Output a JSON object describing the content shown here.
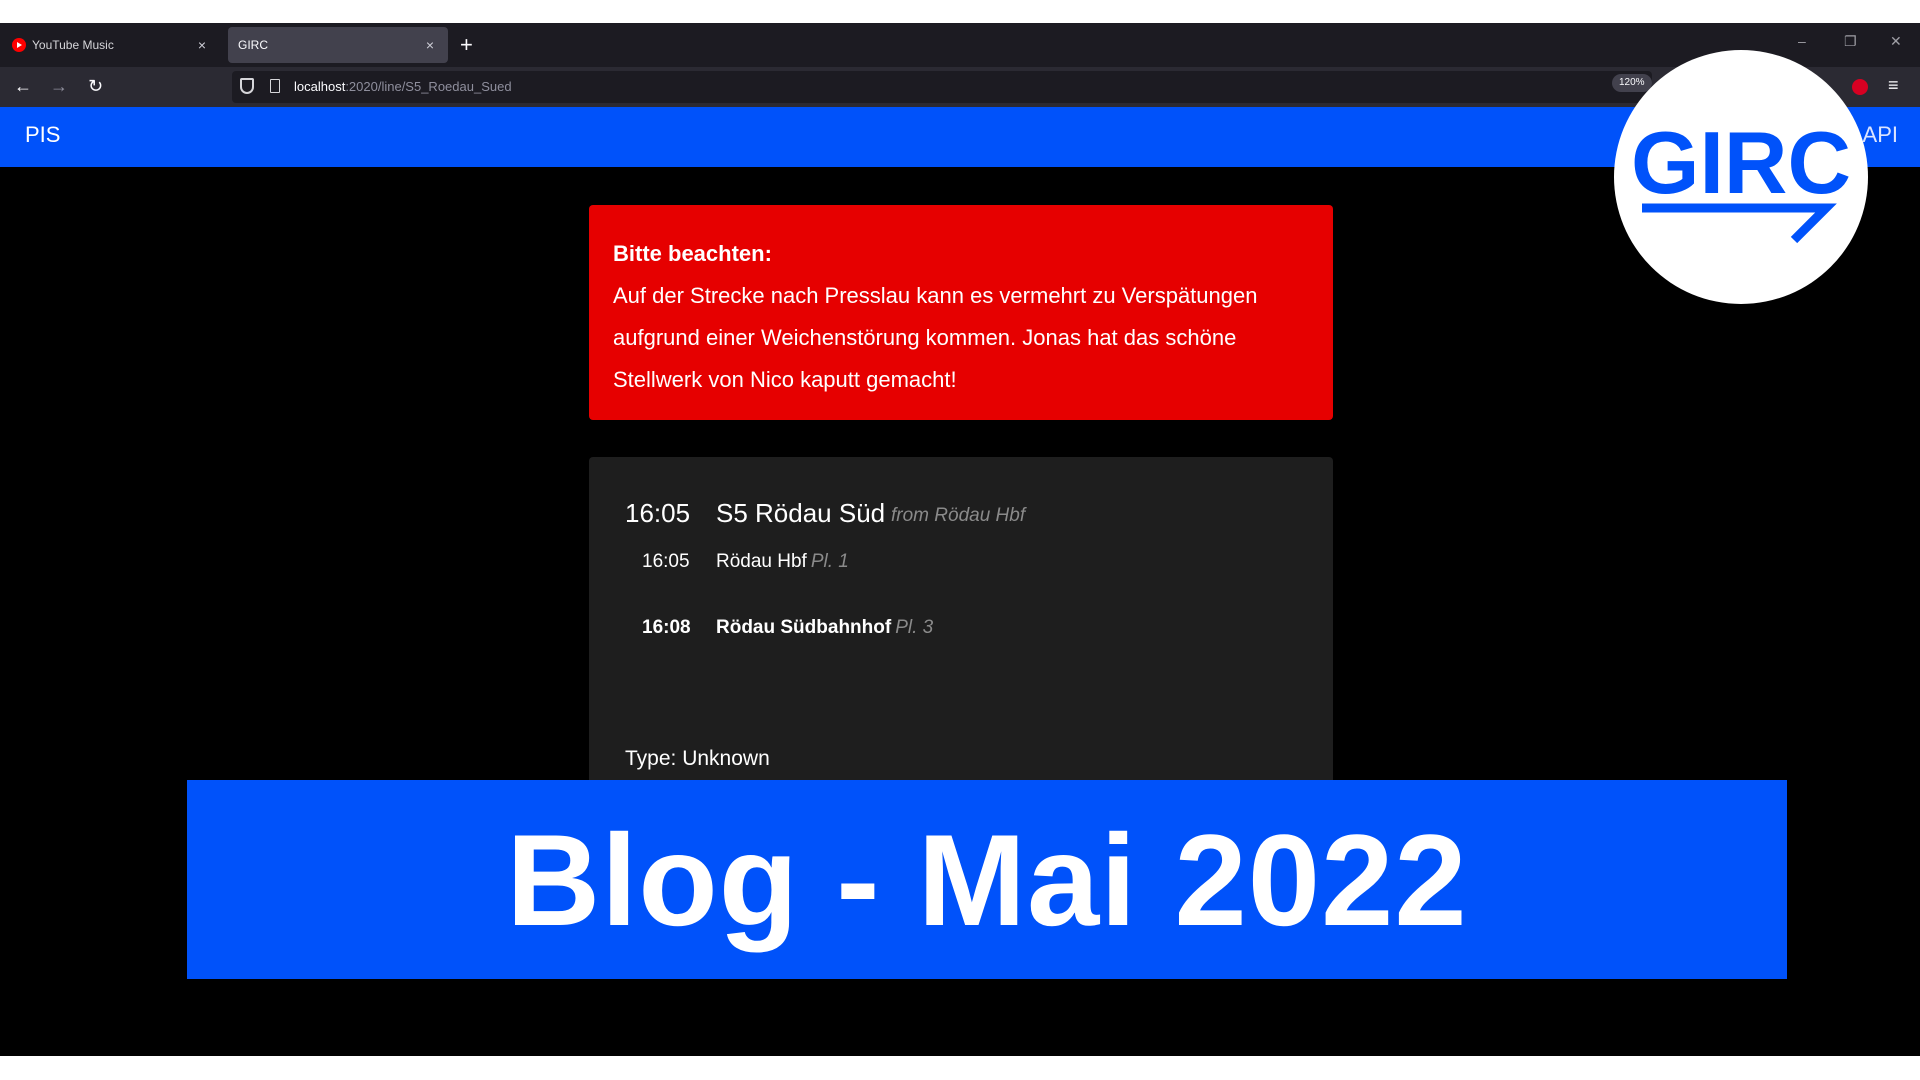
{
  "browser": {
    "tabs": [
      {
        "label": "YouTube Music",
        "close": "×"
      },
      {
        "label": "GIRC",
        "close": "×"
      }
    ],
    "new_tab": "+",
    "window_controls": {
      "minimize": "–",
      "restore": "❐",
      "close": "✕"
    },
    "nav": {
      "back": "←",
      "forward": "→",
      "reload": "↻",
      "menu": "≡"
    },
    "url": {
      "host": "localhost",
      "rest": ":2020/line/S5_Roedau_Sued"
    },
    "zoom": "120%"
  },
  "header": {
    "brand": "PIS",
    "api_link": "API"
  },
  "alert": {
    "title": "Bitte beachten:",
    "body": "Auf der Strecke nach Presslau kann es vermehrt zu Verspätungen aufgrund einer Weichenstörung kommen. Jonas hat das schöne Stellwerk von Nico kaputt gemacht!"
  },
  "trip": {
    "time": "16:05",
    "line": "S5 Rödau Süd",
    "from": "from Rödau Hbf",
    "stops": [
      {
        "time": "16:05",
        "name": "Rödau Hbf",
        "platform": "Pl. 1"
      },
      {
        "time": "16:08",
        "name": "Rödau Südbahnhof",
        "platform": "Pl. 3"
      }
    ],
    "type": "Type: Unknown"
  },
  "banner": {
    "text": "Blog - Mai 2022"
  },
  "logo": {
    "text": "GIRC",
    "color": "#0052fa"
  }
}
